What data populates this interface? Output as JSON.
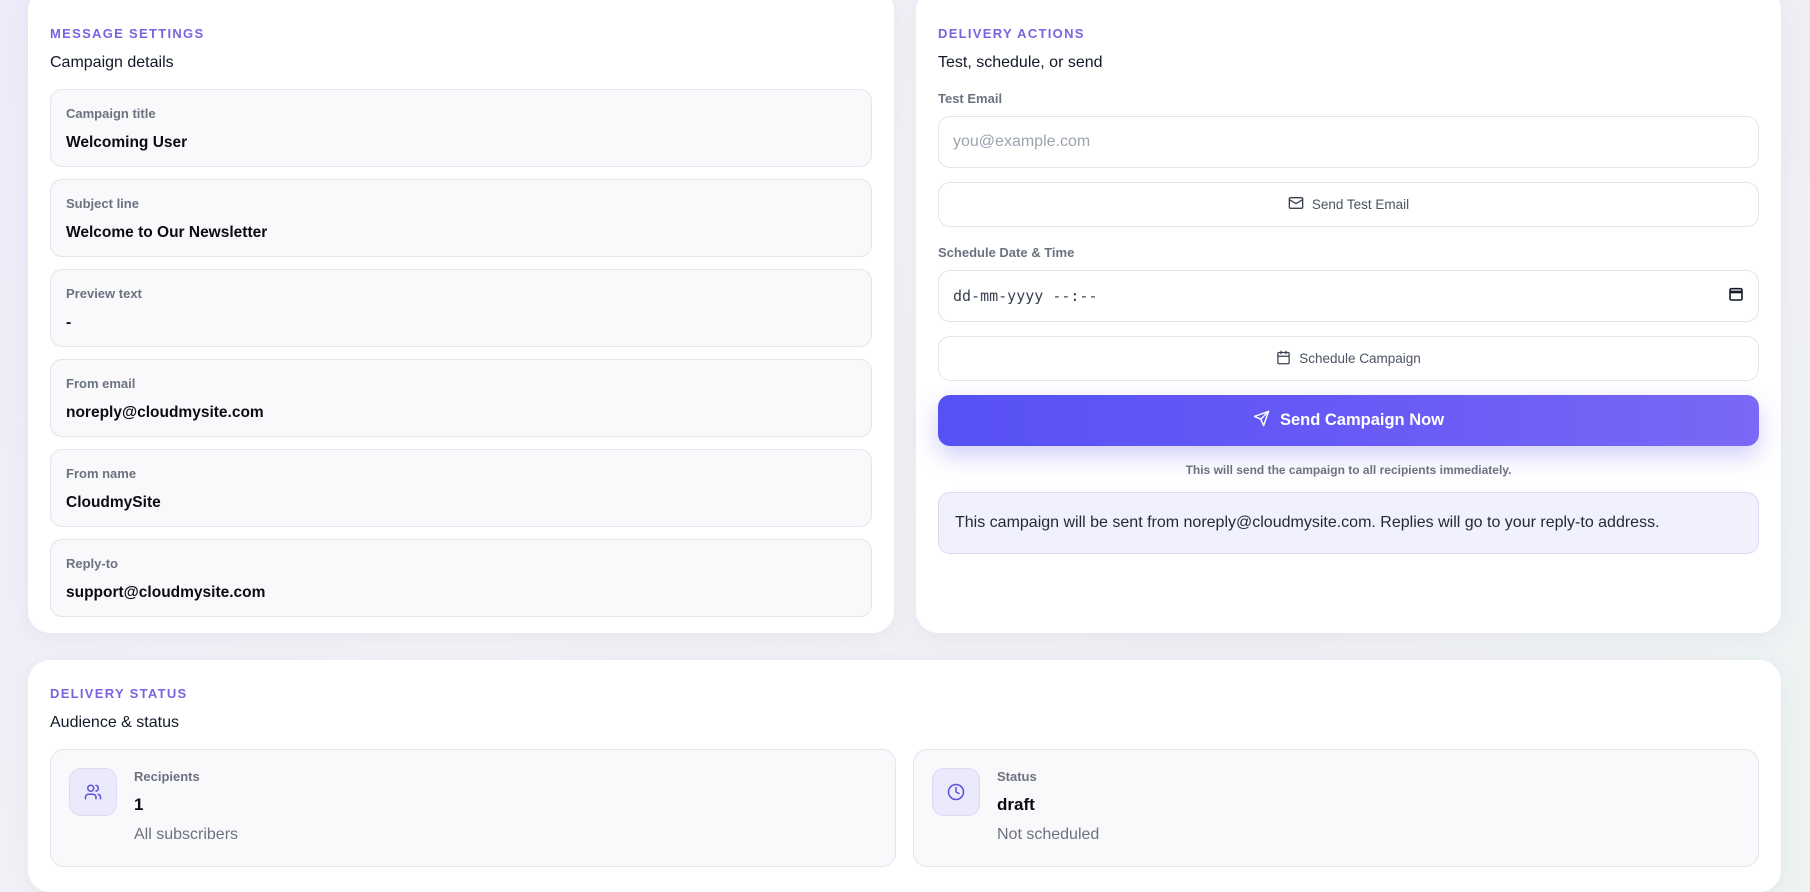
{
  "message_settings": {
    "label": "MESSAGE SETTINGS",
    "subtitle": "Campaign details",
    "fields": [
      {
        "label": "Campaign title",
        "value": "Welcoming User"
      },
      {
        "label": "Subject line",
        "value": "Welcome to Our Newsletter"
      },
      {
        "label": "Preview text",
        "value": "-"
      },
      {
        "label": "From email",
        "value": "noreply@cloudmysite.com"
      },
      {
        "label": "From name",
        "value": "CloudmySite"
      },
      {
        "label": "Reply-to",
        "value": "support@cloudmysite.com"
      }
    ]
  },
  "delivery_actions": {
    "label": "DELIVERY ACTIONS",
    "subtitle": "Test, schedule, or send",
    "test_email_label": "Test Email",
    "test_email_placeholder": "you@example.com",
    "send_test_label": "Send Test Email",
    "schedule_label": "Schedule Date & Time",
    "schedule_placeholder": "dd-mm-yyyy --:--",
    "schedule_button_label": "Schedule Campaign",
    "send_now_label": "Send Campaign Now",
    "send_hint": "This will send the campaign to all recipients immediately.",
    "info_text": "This campaign will be sent from noreply@cloudmysite.com. Replies will go to your reply-to address."
  },
  "delivery_status": {
    "label": "DELIVERY STATUS",
    "subtitle": "Audience & status",
    "recipients": {
      "label": "Recipients",
      "value": "1",
      "sub": "All subscribers",
      "icon": "users-icon"
    },
    "status": {
      "label": "Status",
      "value": "draft",
      "sub": "Not scheduled",
      "icon": "clock-icon"
    }
  },
  "colors": {
    "accent": "#7c62e0",
    "primary": "#5751f4",
    "info_bg": "#f1f0fd"
  }
}
